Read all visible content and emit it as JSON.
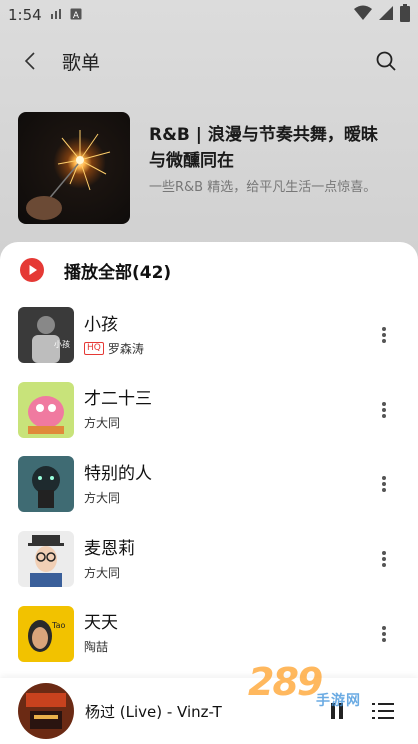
{
  "status_bar": {
    "time": "1:54",
    "battery_icon": "battery-icon",
    "wifi_icon": "wifi-icon",
    "signal_icon": "signal-icon"
  },
  "header": {
    "title": "歌单"
  },
  "playlist": {
    "title": "R&B | 浪漫与节奏共舞，暧昧与微醺同在",
    "description": "一些R&B 精选，给平凡生活一点惊喜。"
  },
  "play_all": {
    "label": "播放全部(42)"
  },
  "songs": [
    {
      "title": "小孩",
      "artist": "罗森涛",
      "hq": "HQ"
    },
    {
      "title": "才二十三",
      "artist": "方大同"
    },
    {
      "title": "特别的人",
      "artist": "方大同"
    },
    {
      "title": "麦恩莉",
      "artist": "方大同"
    },
    {
      "title": "天天",
      "artist": "陶喆"
    }
  ],
  "now_playing": {
    "title": "杨过 (Live) - Vinz-T"
  },
  "watermark": {
    "main": "289",
    "sub": "手游网"
  },
  "colors": {
    "accent": "#e53935",
    "sheet": "#ffffff"
  }
}
